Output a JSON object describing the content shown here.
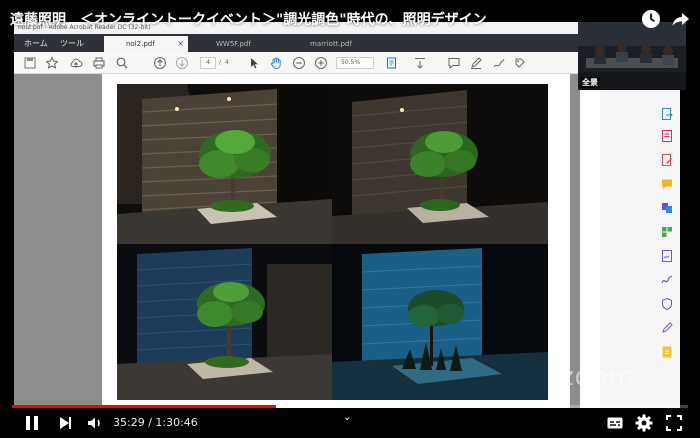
{
  "video": {
    "title": "遠藤照明　＜オンライントークイベント＞\"調光調色\"時代の、照明デザイン",
    "current_time": "35:29",
    "duration": "1:30:46",
    "time_display": "35:29 / 1:30:46",
    "played_fraction": 0.39,
    "buffered_fraction": 0.41
  },
  "acrobat": {
    "title_bar": "nol2.pdf - Adobe Acrobat Reader DC (32-bit)",
    "menu": [
      "ホーム",
      "ツール"
    ],
    "tabs": [
      {
        "label": "nol2.pdf",
        "active": true
      },
      {
        "label": "WW5F.pdf",
        "active": false
      },
      {
        "label": "marriott.pdf",
        "active": false
      }
    ],
    "page_current": "4",
    "page_sep": "/",
    "page_total": "4",
    "zoom": "50.5%"
  },
  "camera": {
    "label": "全景"
  },
  "watermark": "zoom",
  "colors": {
    "progress": "#ff0000",
    "acro_tabbar": "#2f3138"
  }
}
